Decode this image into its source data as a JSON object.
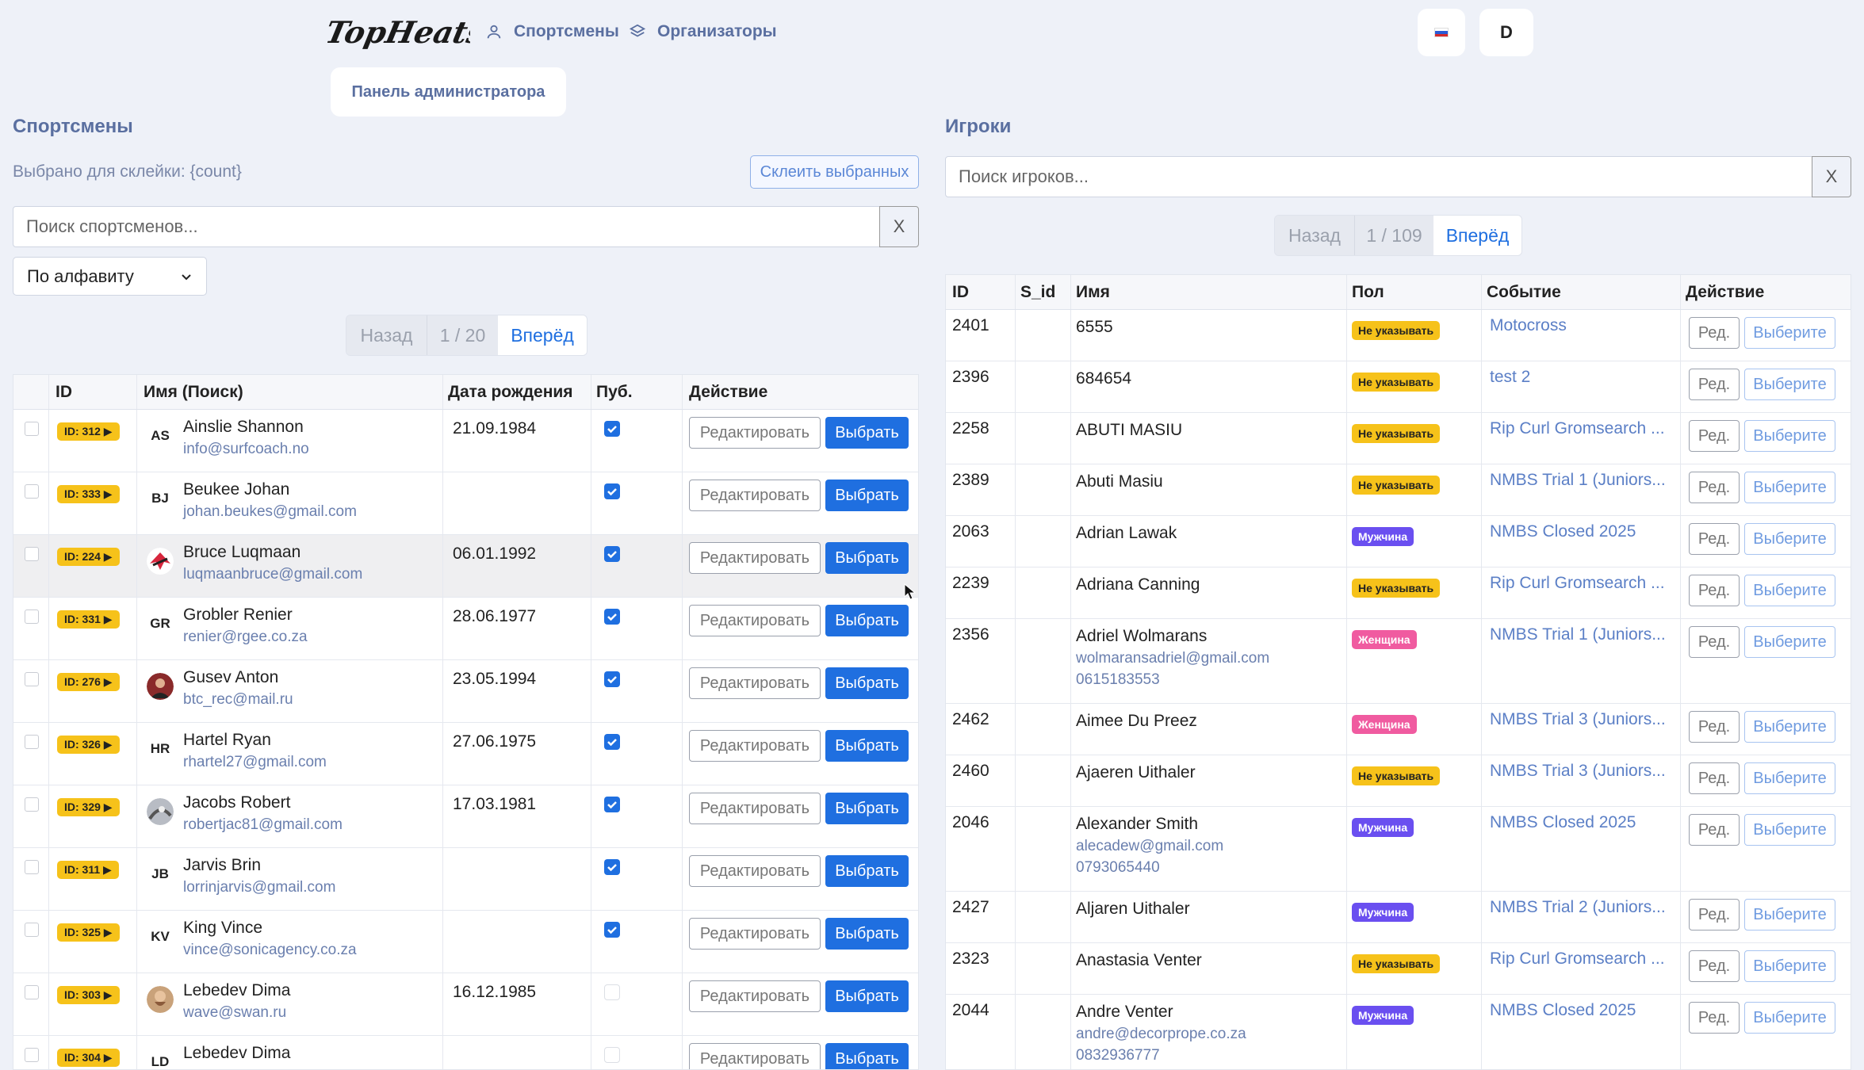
{
  "header": {
    "logo_text": "TopHeats",
    "nav": [
      {
        "label": "Спортсмены",
        "icon": "user-icon"
      },
      {
        "label": "Организаторы",
        "icon": "layers-icon"
      }
    ],
    "admin_label": "Панель администратора",
    "user_initial": "D",
    "flag_icon": "russia-flag-icon"
  },
  "left": {
    "title": "Спортсмены",
    "merge_info": "Выбрано для склейки: {count}",
    "merge_button": "Склеить выбранных",
    "search_placeholder": "Поиск спортсменов...",
    "search_clear": "X",
    "sort_value": "По алфавиту",
    "pager": {
      "prev": "Назад",
      "info": "1 / 20",
      "next": "Вперёд"
    },
    "columns": [
      "ID",
      "Имя (Поиск)",
      "Дата рождения",
      "Пуб.",
      "Действие"
    ],
    "edit_label": "Редактировать",
    "pick_label": "Выбрать",
    "rows": [
      {
        "id": "ID: 312 ▶",
        "initials": "AS",
        "name": "Ainslie Shannon",
        "email": "info@surfcoach.no",
        "dob": "21.09.1984",
        "pub": true
      },
      {
        "id": "ID: 333 ▶",
        "initials": "BJ",
        "name": "Beukee Johan",
        "email": "johan.beukes@gmail.com",
        "dob": "",
        "pub": true
      },
      {
        "id": "ID: 224 ▶",
        "initials": "",
        "name": "Bruce Luqmaan",
        "email": "luqmaanbruce@gmail.com",
        "dob": "06.01.1992",
        "pub": true
      },
      {
        "id": "ID: 331 ▶",
        "initials": "GR",
        "name": "Grobler Renier",
        "email": "renier@rgee.co.za",
        "dob": "28.06.1977",
        "pub": true
      },
      {
        "id": "ID: 276 ▶",
        "initials": "",
        "name": "Gusev Anton",
        "email": "btc_rec@mail.ru",
        "dob": "23.05.1994",
        "pub": true
      },
      {
        "id": "ID: 326 ▶",
        "initials": "HR",
        "name": "Hartel Ryan",
        "email": "rhartel27@gmail.com",
        "dob": "27.06.1975",
        "pub": true
      },
      {
        "id": "ID: 329 ▶",
        "initials": "",
        "name": "Jacobs Robert",
        "email": "robertjac81@gmail.com",
        "dob": "17.03.1981",
        "pub": true
      },
      {
        "id": "ID: 311 ▶",
        "initials": "JB",
        "name": "Jarvis Brin",
        "email": "lorrinjarvis@gmail.com",
        "dob": "",
        "pub": true
      },
      {
        "id": "ID: 325 ▶",
        "initials": "KV",
        "name": "King Vince",
        "email": "vince@sonicagency.co.za",
        "dob": "",
        "pub": true
      },
      {
        "id": "ID: 303 ▶",
        "initials": "",
        "name": "Lebedev Dima",
        "email": "wave@swan.ru",
        "dob": "16.12.1985",
        "pub": false
      },
      {
        "id": "ID: 304 ▶",
        "initials": "LD",
        "name": "Lebedev Dima",
        "email": "",
        "dob": "",
        "pub": false
      }
    ]
  },
  "right": {
    "title": "Игроки",
    "search_placeholder": "Поиск игроков...",
    "search_clear": "X",
    "pager": {
      "prev": "Назад",
      "info": "1 / 109",
      "next": "Вперёд"
    },
    "columns": [
      "ID",
      "S_id",
      "Имя",
      "Пол",
      "Событие",
      "Действие"
    ],
    "edit_label": "Ред.",
    "pick_label": "Выберите",
    "rows": [
      {
        "id": "2401",
        "name": "6555",
        "email": "",
        "phone": "",
        "gender": "Не указывать",
        "g": "none",
        "event": "Motocross"
      },
      {
        "id": "2396",
        "name": "684654",
        "email": "",
        "phone": "",
        "gender": "Не указывать",
        "g": "none",
        "event": "test 2"
      },
      {
        "id": "2258",
        "name": "ABUTI MASIU",
        "email": "",
        "phone": "",
        "gender": "Не указывать",
        "g": "none",
        "event": "Rip Curl Gromsearch ..."
      },
      {
        "id": "2389",
        "name": "Abuti Masiu",
        "email": "",
        "phone": "",
        "gender": "Не указывать",
        "g": "none",
        "event": "NMBS Trial 1 (Juniors..."
      },
      {
        "id": "2063",
        "name": "Adrian Lawak",
        "email": "",
        "phone": "",
        "gender": "Мужчина",
        "g": "m",
        "event": "NMBS Closed 2025"
      },
      {
        "id": "2239",
        "name": "Adriana Canning",
        "email": "",
        "phone": "",
        "gender": "Не указывать",
        "g": "none",
        "event": "Rip Curl Gromsearch ..."
      },
      {
        "id": "2356",
        "name": "Adriel Wolmarans",
        "email": "wolmaransadriel@gmail.com",
        "phone": "0615183553",
        "gender": "Женщина",
        "g": "f",
        "event": "NMBS Trial 1 (Juniors..."
      },
      {
        "id": "2462",
        "name": "Aimee Du Preez",
        "email": "",
        "phone": "",
        "gender": "Женщина",
        "g": "f",
        "event": "NMBS Trial 3 (Juniors..."
      },
      {
        "id": "2460",
        "name": "Ajaeren Uithaler",
        "email": "",
        "phone": "",
        "gender": "Не указывать",
        "g": "none",
        "event": "NMBS Trial 3 (Juniors..."
      },
      {
        "id": "2046",
        "name": "Alexander Smith",
        "email": "alecadew@gmail.com",
        "phone": "0793065440",
        "gender": "Мужчина",
        "g": "m",
        "event": "NMBS Closed 2025"
      },
      {
        "id": "2427",
        "name": "Aljaren Uithaler",
        "email": "",
        "phone": "",
        "gender": "Мужчина",
        "g": "m",
        "event": "NMBS Trial 2 (Juniors..."
      },
      {
        "id": "2323",
        "name": "Anastasia Venter",
        "email": "",
        "phone": "",
        "gender": "Не указывать",
        "g": "none",
        "event": "Rip Curl Gromsearch ..."
      },
      {
        "id": "2044",
        "name": "Andre Venter",
        "email": "andre@decorprope.co.za",
        "phone": "0832936777",
        "gender": "Мужчина",
        "g": "m",
        "event": "NMBS Closed 2025"
      }
    ]
  }
}
